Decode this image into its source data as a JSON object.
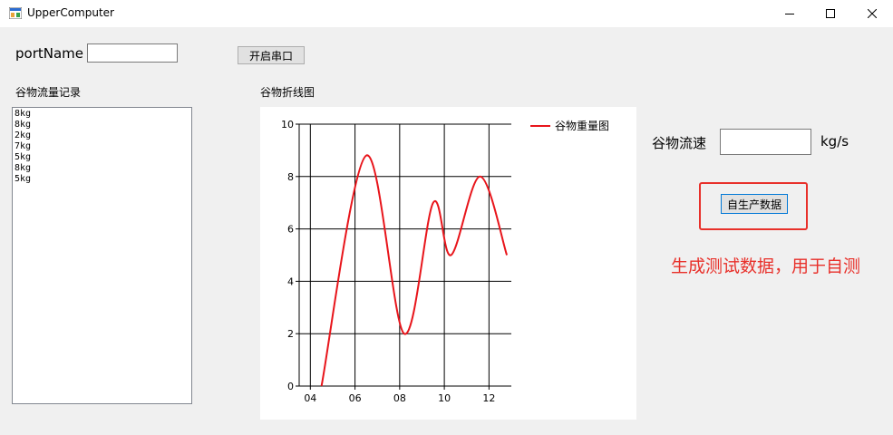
{
  "window": {
    "title": "UpperComputer"
  },
  "port": {
    "label": "portName",
    "value": "",
    "open_button": "开启串口"
  },
  "records": {
    "title": "谷物流量记录",
    "items": [
      "8kg",
      "8kg",
      "2kg",
      "7kg",
      "5kg",
      "8kg",
      "5kg"
    ]
  },
  "chart_title": "谷物折线图",
  "flow": {
    "label": "谷物流速",
    "value": "",
    "unit": "kg/s"
  },
  "generate_button": "自生产数据",
  "annotation": "生成测试数据，用于自测",
  "colors": {
    "series": "#e8151b",
    "annotation": "#e8302a"
  },
  "chart_data": {
    "type": "line",
    "smooth": true,
    "x_tick_labels": [
      "04",
      "06",
      "08",
      "10",
      "12"
    ],
    "x_ticks": [
      4,
      6,
      8,
      10,
      12
    ],
    "xlim": [
      3.5,
      13
    ],
    "ylim": [
      0,
      10
    ],
    "y_ticks": [
      0,
      2,
      4,
      6,
      8,
      10
    ],
    "grid": true,
    "legend": "top-right",
    "series": [
      {
        "name": "谷物重量图",
        "color": "#e8151b",
        "points": [
          [
            4.5,
            0
          ],
          [
            6.5,
            8.8
          ],
          [
            8.2,
            2
          ],
          [
            9.5,
            7
          ],
          [
            10.3,
            5
          ],
          [
            11.6,
            8
          ],
          [
            12.8,
            5
          ]
        ]
      }
    ]
  }
}
